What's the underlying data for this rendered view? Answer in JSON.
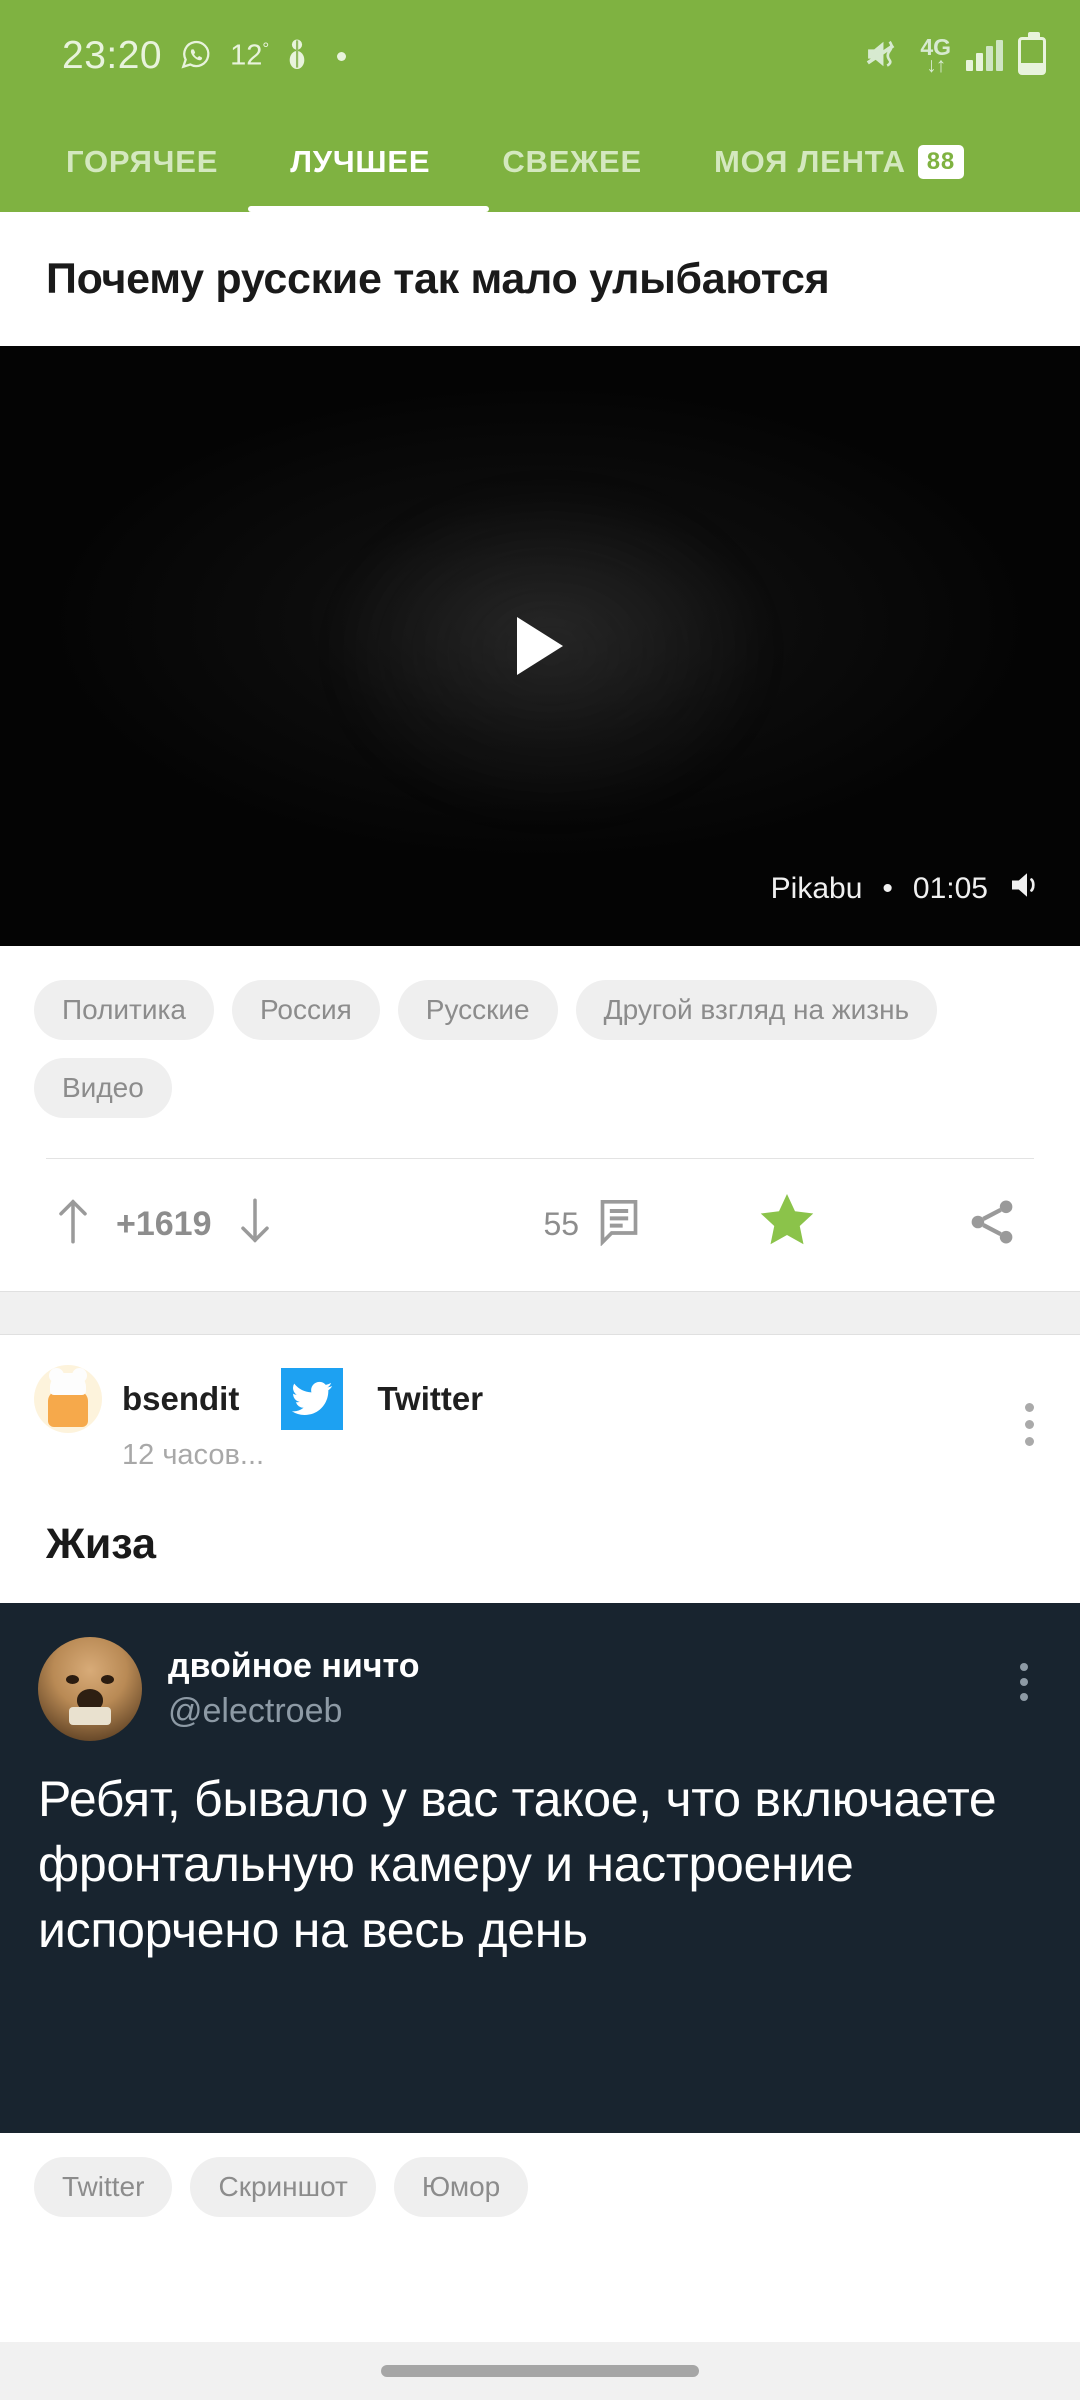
{
  "statusbar": {
    "time": "23:20",
    "whatsapp_icon": "whatsapp-icon",
    "temperature": "12",
    "degree": "°",
    "snowman_icon": "snowman-icon",
    "mute_icon": "mute-vibrate-icon",
    "network_label": "4G",
    "network_arrows": "↓↑",
    "signal_icon": "signal-bars-icon",
    "battery_icon": "battery-low-icon"
  },
  "tabs": {
    "items": [
      {
        "label": "ГОРЯЧЕЕ",
        "active": false
      },
      {
        "label": "ЛУЧШЕЕ",
        "active": true
      },
      {
        "label": "СВЕЖЕЕ",
        "active": false
      },
      {
        "label": "МОЯ ЛЕНТА",
        "active": false
      }
    ],
    "feed_badge": "88"
  },
  "post1": {
    "title": "Почему русские так мало улыбаются",
    "video": {
      "source": "Pikabu",
      "separator": "•",
      "duration": "01:05",
      "play_icon": "play-icon",
      "sound_icon": "speaker-on-icon"
    },
    "tags": [
      "Политика",
      "Россия",
      "Русские",
      "Другой взгляд на жизнь",
      "Видео"
    ],
    "actions": {
      "upvote_icon": "arrow-up-icon",
      "score": "+1619",
      "downvote_icon": "arrow-down-icon",
      "comments_count": "55",
      "comments_icon": "comment-icon",
      "save_icon": "star-icon",
      "save_color": "#8bc34a",
      "share_icon": "share-icon"
    }
  },
  "post2": {
    "author": {
      "avatar_icon": "user-avatar-bread-chef",
      "username": "bsendit",
      "community_icon": "twitter-bird-icon",
      "community": "Twitter",
      "time_ago": "12 часов...",
      "menu_icon": "kebab-menu-icon"
    },
    "title": "Жиза",
    "tweet": {
      "avatar_icon": "chewbacca-avatar",
      "display_name": "двойное ничто",
      "handle": "@electroeb",
      "menu_icon": "kebab-menu-icon",
      "text": "Ребят, бывало у вас такое, что включаете фронтальную камеру и настроение испорчено на весь день"
    },
    "tags": [
      "Twitter",
      "Скриншот",
      "Юмор"
    ]
  },
  "navbar": {
    "handle_icon": "home-gesture-handle"
  },
  "colors": {
    "brand_green": "#7fb241",
    "accent_green": "#8bc34a",
    "twitter_blue": "#1da1f2",
    "tweet_bg": "#18242f"
  }
}
